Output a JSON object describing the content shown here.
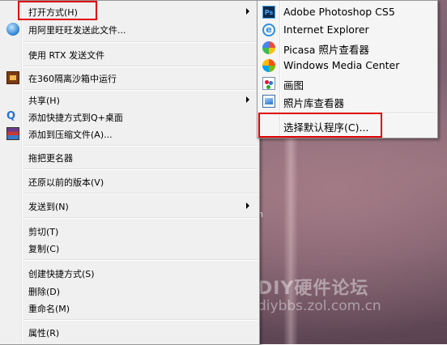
{
  "background": {
    "fragment_text": "n",
    "watermark_title": "DIY硬件论坛",
    "watermark_url": "diybbs.zol.com.cn"
  },
  "context_menu": {
    "items": [
      {
        "label": "打开方式(H)",
        "has_submenu": true
      },
      {
        "label": "用阿里旺旺发送此文件...",
        "icon": "aliwangwang-icon"
      },
      {
        "label": "使用 RTX 发送文件"
      },
      {
        "label": "在360隔离沙箱中运行",
        "icon": "360-sandbox-icon"
      },
      {
        "label": "共享(H)",
        "has_submenu": true
      },
      {
        "label": "添加快捷方式到Q+桌面",
        "icon": "qplus-icon"
      },
      {
        "label": "添加到压缩文件(A)...",
        "icon": "winrar-icon"
      },
      {
        "label": "拖把更名器"
      },
      {
        "label": "还原以前的版本(V)"
      },
      {
        "label": "发送到(N)",
        "has_submenu": true
      },
      {
        "label": "剪切(T)"
      },
      {
        "label": "复制(C)"
      },
      {
        "label": "创建快捷方式(S)"
      },
      {
        "label": "删除(D)"
      },
      {
        "label": "重命名(M)"
      },
      {
        "label": "属性(R)"
      }
    ]
  },
  "open_with_submenu": {
    "items": [
      {
        "label": "Adobe Photoshop CS5",
        "icon": "photoshop-icon"
      },
      {
        "label": "Internet Explorer",
        "icon": "internet-explorer-icon"
      },
      {
        "label": "Picasa 照片查看器",
        "icon": "picasa-icon"
      },
      {
        "label": "Windows Media Center",
        "icon": "windows-media-center-icon"
      },
      {
        "label": "画图",
        "icon": "paint-icon"
      },
      {
        "label": "照片库查看器",
        "icon": "photo-gallery-viewer-icon"
      },
      {
        "label": "选择默认程序(C)..."
      }
    ]
  },
  "highlight_color": "#e00000"
}
